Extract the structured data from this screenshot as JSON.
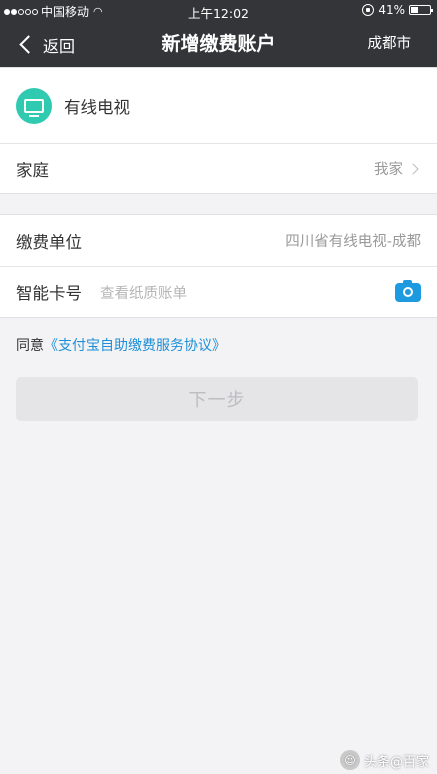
{
  "status_bar": {
    "carrier": "中国移动",
    "time": "上午12:02",
    "battery_percent": "41%",
    "battery_level": 0.41,
    "signal_strength": 2,
    "signal_total": 5
  },
  "nav": {
    "back_label": "返回",
    "title": "新增缴费账户",
    "city": "成都市"
  },
  "category": {
    "icon": "tv-icon",
    "label": "有线电视",
    "color": "#2fcab0"
  },
  "group": {
    "label": "家庭",
    "value": "我家"
  },
  "payee": {
    "label": "缴费单位",
    "value": "四川省有线电视-成都"
  },
  "card": {
    "label": "智能卡号",
    "placeholder": "查看纸质账单",
    "icon": "camera-icon",
    "icon_color": "#1e9ae0"
  },
  "agreement": {
    "prefix": "同意",
    "link": "《支付宝自助缴费服务协议》",
    "link_color": "#1d8fd6"
  },
  "next_button": {
    "label": "下一步"
  },
  "watermark": {
    "text": "头条@百家"
  }
}
